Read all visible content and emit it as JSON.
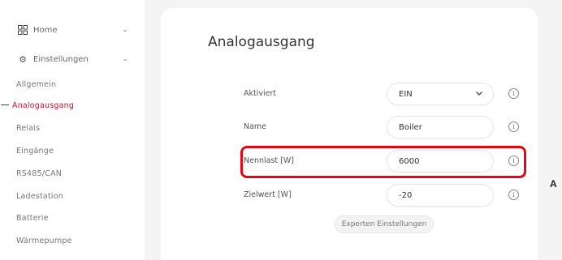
{
  "sidebar": {
    "home": {
      "label": "Home",
      "icon": "home-icon"
    },
    "settings": {
      "label": "Einstellungen",
      "icon": "gear-icon"
    },
    "items": [
      {
        "label": "Allgemein",
        "active": false
      },
      {
        "label": "Analogausgang",
        "active": true
      },
      {
        "label": "Relais",
        "active": false
      },
      {
        "label": "Eingänge",
        "active": false
      },
      {
        "label": "RS485/CAN",
        "active": false
      },
      {
        "label": "Ladestation",
        "active": false
      },
      {
        "label": "Batterie",
        "active": false
      },
      {
        "label": "Wärmepumpe",
        "active": false
      }
    ]
  },
  "main": {
    "title": "Analogausgang",
    "fields": [
      {
        "label": "Aktiviert",
        "value": "EIN",
        "type": "select"
      },
      {
        "label": "Name",
        "value": "Boiler",
        "type": "text"
      },
      {
        "label": "Nennlast [W]",
        "value": "6000",
        "type": "number"
      },
      {
        "label": "Zielwert [W]",
        "value": "-20",
        "type": "number"
      }
    ],
    "expert_button": "Experten Einstellungen",
    "info_glyph": "i"
  },
  "annotation": {
    "marker": "A",
    "color": "#e30613"
  },
  "colors": {
    "accent": "#c8102e",
    "main_bg": "#f4f4f4"
  }
}
